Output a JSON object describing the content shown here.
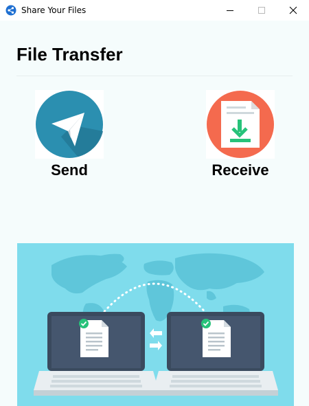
{
  "window": {
    "title": "Share Your Files"
  },
  "page": {
    "heading": "File Transfer"
  },
  "actions": {
    "send": {
      "label": "Send",
      "icon": "paper-plane-icon",
      "color": "#2b8fb0"
    },
    "receive": {
      "label": "Receive",
      "icon": "file-download-icon",
      "color": "#f46a4e"
    }
  },
  "illustration": {
    "description_icon": "file-transfer-laptops-illustration",
    "background_color": "#7fdcec"
  },
  "colors": {
    "accent_green": "#27c27a",
    "laptop_screen": "#45566e"
  }
}
